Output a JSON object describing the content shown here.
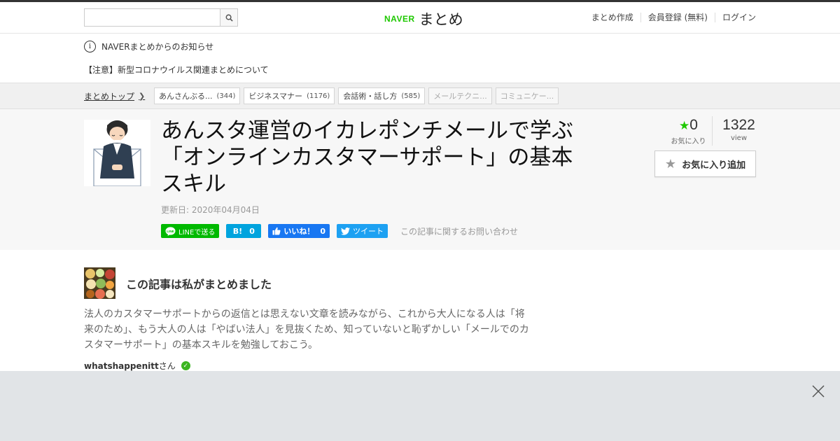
{
  "header": {
    "search": {
      "value": "",
      "placeholder": ""
    },
    "logo": {
      "naver": "NAVER",
      "matome": "まとめ"
    },
    "nav": [
      "まとめ作成",
      "会員登録 (無料)",
      "ログイン"
    ]
  },
  "notice": {
    "title": "NAVERまとめからのお知らせ",
    "link": "【注意】新型コロナウイルス関連まとめについて"
  },
  "breadcrumb": {
    "home": "まとめトップ",
    "tags": [
      {
        "label": "あんさんぶる...",
        "count": "(344)",
        "dim": false
      },
      {
        "label": "ビジネスマナー",
        "count": "(1176)",
        "dim": false
      },
      {
        "label": "会話術・話し方",
        "count": "(585)",
        "dim": false
      },
      {
        "label": "メールテクニ...",
        "count": "",
        "dim": true
      },
      {
        "label": "コミュニケー...",
        "count": "",
        "dim": true
      }
    ]
  },
  "article": {
    "title": "あんスタ運営のイカレポンチメールで学ぶ「オンラインカスタマーサポート」の基本スキル",
    "updated": "更新日: 2020年04月04日",
    "share": {
      "line": "LINEで送る",
      "hatena_icon": "B!",
      "hatena_count": "0",
      "facebook": "いいね！",
      "facebook_count": "0",
      "twitter": "ツイート",
      "inquiry": "この記事に関するお問い合わせ"
    },
    "stats": {
      "favorites": "0",
      "favorites_label": "お気に入り",
      "views": "1322",
      "views_label": "view"
    },
    "favorite_button": "お気に入り追加"
  },
  "author": {
    "heading": "この記事は私がまとめました",
    "description": "法人のカスタマーサポートからの返信とは思えない文章を読みながら、これから大人になる人は「将来のため」、もう大人の人は「やばい法人」を見抜くため、知っていないと恥ずかしい「メールでのカスタマーサポート」の基本スキルを勉強しておこう。",
    "name": "whatshappenitt",
    "suffix": "さん"
  },
  "colors": {
    "brand_green": "#1ec800",
    "line_green": "#00b900",
    "hatena_blue": "#00a4de",
    "facebook_blue": "#1877f2",
    "twitter_blue": "#1da1f2"
  }
}
